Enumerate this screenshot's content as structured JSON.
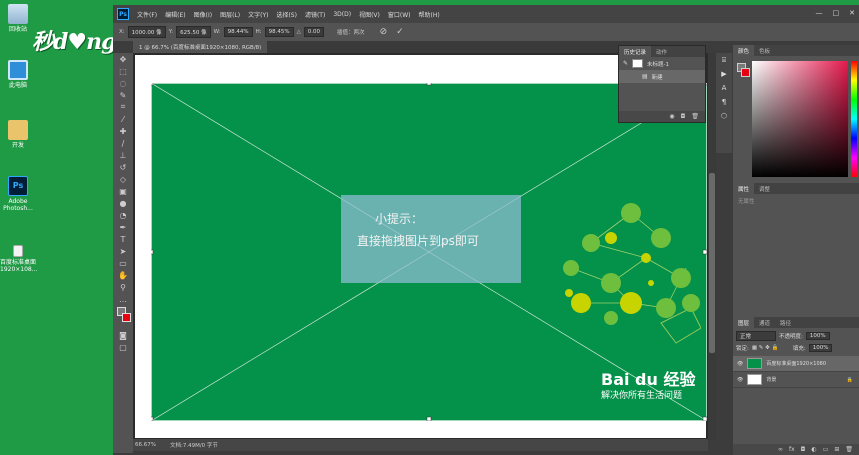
{
  "desktop": {
    "watermark": "秒d♥ng视频",
    "icons": [
      {
        "label": "回收站",
        "name": "recycle-bin-icon"
      },
      {
        "label": "此电脑",
        "name": "this-pc-icon"
      },
      {
        "label": "开发",
        "name": "folder-icon"
      },
      {
        "label": "Adobe\nPhotosh...",
        "name": "photoshop-icon"
      },
      {
        "label": "百度标准桌面\n1920×108...",
        "name": "image-file-icon"
      }
    ]
  },
  "menu": {
    "logo": "Ps",
    "items": [
      "文件(F)",
      "编辑(E)",
      "图像(I)",
      "图层(L)",
      "文字(Y)",
      "选择(S)",
      "滤镜(T)",
      "3D(D)",
      "视图(V)",
      "窗口(W)",
      "帮助(H)"
    ],
    "controls": [
      "—",
      "□",
      "✕"
    ]
  },
  "options": {
    "x_label": "X:",
    "x_value": "1000.00 像",
    "y_label": "Y:",
    "y_value": "625.50 像",
    "w_label": "W:",
    "w_value": "98.44%",
    "h_label": "H:",
    "h_value": "98.45%",
    "angle_label": "△",
    "angle_value": "0.00",
    "interp": "插值：两次",
    "cancel": "⊘",
    "commit": "✓"
  },
  "document": {
    "tab_title": "1 @ 66.7% (百度标准桌面1920×1080, RGB/8)",
    "hint_title": "小提示：",
    "hint_body": "直接拖拽图片到ps即可",
    "baidu_logo": "Bai du 经验",
    "baidu_slogan": "解决你所有生活问题"
  },
  "status": {
    "zoom": "66.67%",
    "doc": "文档:7.49M/0 字节"
  },
  "history": {
    "tabs": [
      "历史记录",
      "动作"
    ],
    "snapshot": "未标题-1",
    "step": "新建"
  },
  "color_panel": {
    "tabs": [
      "颜色",
      "色板"
    ],
    "fg_color": "#7a7a7a",
    "bg_color": "#e60012"
  },
  "properties": {
    "tabs": [
      "属性",
      "调整"
    ],
    "empty": "无属性"
  },
  "layers": {
    "tabs": [
      "图层",
      "通道",
      "路径"
    ],
    "blend_mode": "正常",
    "opacity_label": "不透明度:",
    "opacity_value": "100%",
    "lock_label": "锁定:",
    "fill_label": "填充:",
    "fill_value": "100%",
    "items": [
      {
        "name": "百度标准桌面1920×1080",
        "thumb_color": "#04914a"
      },
      {
        "name": "背景",
        "thumb_color": "#ffffff"
      }
    ]
  }
}
